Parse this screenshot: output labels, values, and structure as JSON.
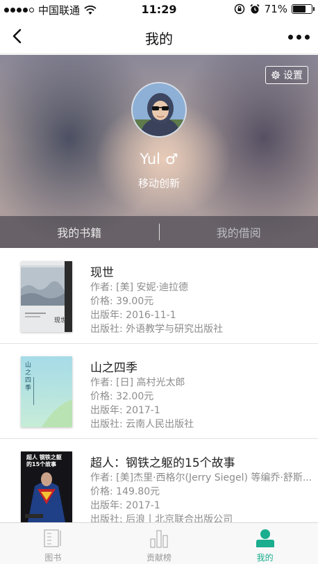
{
  "status_bar": {
    "carrier": "中国联通",
    "time": "11:29",
    "battery": "71%",
    "battery_level": 0.71,
    "icons": [
      "signal-dots-icon",
      "wifi-icon",
      "rotation-lock-icon",
      "alarm-icon",
      "battery-icon"
    ]
  },
  "nav": {
    "title": "我的",
    "back_icon": "chevron-left-icon",
    "more_icon": "more-dots-icon"
  },
  "profile": {
    "settings_label": "设置",
    "settings_icon": "gear-icon",
    "username": "Yul ♂",
    "organization": "移动创新",
    "tabs": [
      {
        "label": "我的书籍"
      },
      {
        "label": "我的借阅"
      }
    ]
  },
  "books": [
    {
      "title": "现世",
      "author": "作者: [美] 安妮·迪拉德",
      "price": "价格: 39.00元",
      "date": "出版年: 2016-11-1",
      "publisher": "出版社: 外语教学与研究出版社",
      "cover_text": "现世"
    },
    {
      "title": "山之四季",
      "author": "作者: [日] 高村光太郎",
      "price": "价格: 32.00元",
      "date": "出版年: 2017-1",
      "publisher": "出版社: 云南人民出版社",
      "cover_text": "山之四季"
    },
    {
      "title": "超人：钢铁之躯的15个故事",
      "author": "作者: [美]杰里·西格尔(Jerry Siegel) 等编乔·舒斯...",
      "price": "价格: 149.80元",
      "date": "出版年: 2017-1",
      "publisher": "出版社: 后浪丨北京联合出版公司",
      "cover_text": "超人 钢铁之躯的15个故事"
    }
  ],
  "tab_bar": {
    "items": [
      {
        "label": "图书",
        "icon": "book-icon",
        "active": false
      },
      {
        "label": "贡献榜",
        "icon": "bar-chart-icon",
        "active": false
      },
      {
        "label": "我的",
        "icon": "user-icon",
        "active": true
      }
    ],
    "accent_color": "#1aad8e",
    "inactive_color": "#999999"
  }
}
